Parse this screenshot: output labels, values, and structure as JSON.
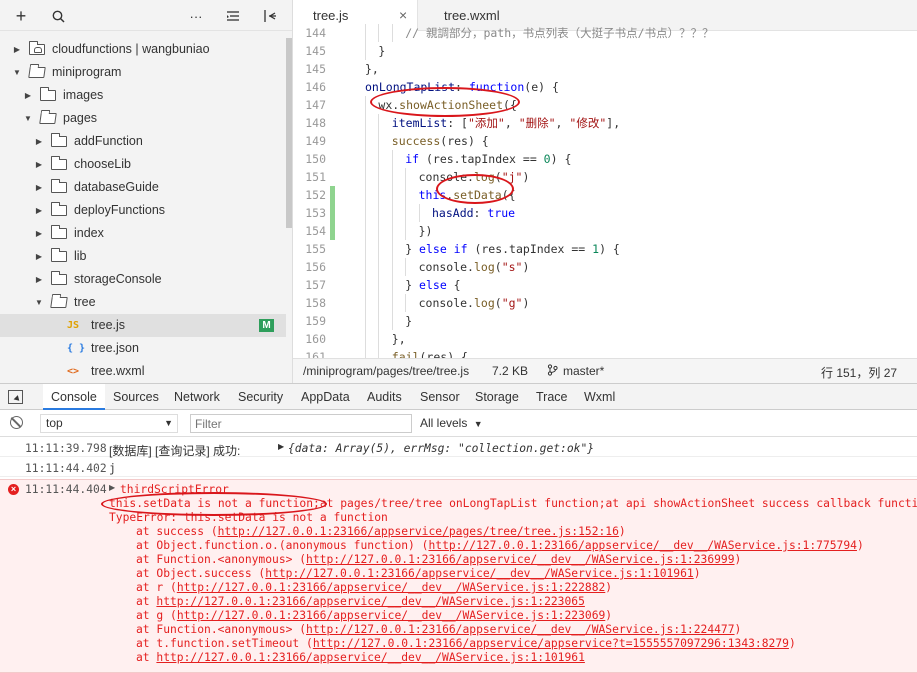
{
  "sidebar": {
    "toolbar": [
      "+",
      "search-icon",
      "···",
      "sort-icon",
      "collapse-icon"
    ],
    "tree": [
      {
        "label": "cloudfunctions | wangbuniao",
        "depth": 0,
        "expanded": false,
        "kind": "cloud-folder"
      },
      {
        "label": "miniprogram",
        "depth": 0,
        "expanded": true,
        "kind": "folder"
      },
      {
        "label": "images",
        "depth": 1,
        "expanded": false,
        "kind": "folder"
      },
      {
        "label": "pages",
        "depth": 1,
        "expanded": true,
        "kind": "folder"
      },
      {
        "label": "addFunction",
        "depth": 2,
        "expanded": false,
        "kind": "folder"
      },
      {
        "label": "chooseLib",
        "depth": 2,
        "expanded": false,
        "kind": "folder"
      },
      {
        "label": "databaseGuide",
        "depth": 2,
        "expanded": false,
        "kind": "folder"
      },
      {
        "label": "deployFunctions",
        "depth": 2,
        "expanded": false,
        "kind": "folder"
      },
      {
        "label": "index",
        "depth": 2,
        "expanded": false,
        "kind": "folder"
      },
      {
        "label": "lib",
        "depth": 2,
        "expanded": false,
        "kind": "folder"
      },
      {
        "label": "storageConsole",
        "depth": 2,
        "expanded": false,
        "kind": "folder"
      },
      {
        "label": "tree",
        "depth": 2,
        "expanded": true,
        "kind": "folder"
      },
      {
        "label": "tree.js",
        "depth": 3,
        "kind": "js",
        "icon_text": "JS",
        "badge": "M",
        "selected": true
      },
      {
        "label": "tree.json",
        "depth": 3,
        "kind": "json",
        "icon_text": "{ }"
      },
      {
        "label": "tree.wxml",
        "depth": 3,
        "kind": "wxml",
        "icon_text": "<>"
      }
    ]
  },
  "editor": {
    "tabs": [
      {
        "label": "tree.js",
        "active": true,
        "close": "×"
      },
      {
        "label": "tree.wxml",
        "active": false
      }
    ],
    "lines": [
      {
        "n": "144",
        "indent": 3,
        "html": "<span class='cm'>// 親調部分，path，书点列表（大挺子书点/书点）？？？</span>"
      },
      {
        "n": "145",
        "indent": 1,
        "html": "}"
      },
      {
        "n": "145",
        "indent": 0,
        "html": "},"
      },
      {
        "n": "146",
        "indent": 0,
        "html": "<span class='prop'>onLongTapList</span>: <span class='kw'>function</span>(e) {"
      },
      {
        "n": "147",
        "indent": 1,
        "html": "wx.<span class='fn'>showActionSheet</span>({"
      },
      {
        "n": "148",
        "indent": 2,
        "html": "<span class='prop'>itemList</span>: [<span class='str'>\"添加\"</span>, <span class='str'>\"删除\"</span>, <span class='str'>\"修改\"</span>],"
      },
      {
        "n": "149",
        "indent": 2,
        "html": "<span class='fn'>success</span>(res) {"
      },
      {
        "n": "150",
        "indent": 3,
        "html": "<span class='kw'>if</span> (res.tapIndex == <span class='num'>0</span>) {"
      },
      {
        "n": "151",
        "indent": 4,
        "html": "console.<span class='fn'>log</span>(<span class='str'>\"j\"</span>)"
      },
      {
        "n": "152",
        "indent": 4,
        "html": "<span class='kw'>this</span>.<span class='fn'>setData</span>({",
        "mark": true
      },
      {
        "n": "153",
        "indent": 5,
        "html": "<span class='prop'>hasAdd</span>: <span class='kw'>true</span>",
        "mark": true
      },
      {
        "n": "154",
        "indent": 4,
        "html": "})",
        "mark": true
      },
      {
        "n": "155",
        "indent": 3,
        "html": "} <span class='kw'>else if</span> (res.tapIndex == <span class='num'>1</span>) {"
      },
      {
        "n": "156",
        "indent": 4,
        "html": "console.<span class='fn'>log</span>(<span class='str'>\"s\"</span>)"
      },
      {
        "n": "157",
        "indent": 3,
        "html": "} <span class='kw'>else</span> {"
      },
      {
        "n": "158",
        "indent": 4,
        "html": "console.<span class='fn'>log</span>(<span class='str'>\"g\"</span>)"
      },
      {
        "n": "159",
        "indent": 3,
        "html": "}"
      },
      {
        "n": "160",
        "indent": 2,
        "html": "},"
      },
      {
        "n": "161",
        "indent": 2,
        "html": "<span class='fn'>fail</span>(res) {"
      }
    ],
    "status": {
      "path": "/miniprogram/pages/tree/tree.js",
      "size": "7.2 KB",
      "branch": "master*",
      "position": "行 151，列 27"
    }
  },
  "devtools": {
    "tabs": [
      "Console",
      "Sources",
      "Network",
      "Security",
      "AppData",
      "Audits",
      "Sensor",
      "Storage",
      "Trace",
      "Wxml"
    ],
    "active_tab": "Console",
    "context": "top",
    "filter_placeholder": "Filter",
    "levels": "All levels"
  },
  "console": {
    "messages": [
      {
        "time": "11:11:39.798",
        "text": "[数据库] [查询记录] 成功:",
        "object": "{data: Array(5), errMsg: \"collection.get:ok\"}"
      },
      {
        "time": "11:11:44.402",
        "text": "j"
      }
    ],
    "error": {
      "time": "11:11:44.404",
      "title": "thirdScriptError",
      "message": "this.setData is not a function;at pages/tree/tree onLongTapList function;at api showActionSheet success callback function",
      "type": "TypeError: this.setData is not a function",
      "stack": [
        {
          "prefix": "at success (",
          "link": "http://127.0.0.1:23166/appservice/pages/tree/tree.js:152:16",
          "suffix": ")"
        },
        {
          "prefix": "at Object.function.o.(anonymous function) (",
          "link": "http://127.0.0.1:23166/appservice/__dev__/WAService.js:1:775794",
          "suffix": ")"
        },
        {
          "prefix": "at Function.<anonymous> (",
          "link": "http://127.0.0.1:23166/appservice/__dev__/WAService.js:1:236999",
          "suffix": ")"
        },
        {
          "prefix": "at Object.success (",
          "link": "http://127.0.0.1:23166/appservice/__dev__/WAService.js:1:101961",
          "suffix": ")"
        },
        {
          "prefix": "at r (",
          "link": "http://127.0.0.1:23166/appservice/__dev__/WAService.js:1:222882",
          "suffix": ")"
        },
        {
          "prefix": "at ",
          "link": "http://127.0.0.1:23166/appservice/__dev__/WAService.js:1:223065",
          "suffix": ""
        },
        {
          "prefix": "at g (",
          "link": "http://127.0.0.1:23166/appservice/__dev__/WAService.js:1:223069",
          "suffix": ")"
        },
        {
          "prefix": "at Function.<anonymous> (",
          "link": "http://127.0.0.1:23166/appservice/__dev__/WAService.js:1:224477",
          "suffix": ")"
        },
        {
          "prefix": "at t.function.setTimeout (",
          "link": "http://127.0.0.1:23166/appservice/appservice?t=1555557097296:1343:8279",
          "suffix": ")"
        },
        {
          "prefix": "at ",
          "link": "http://127.0.0.1:23166/appservice/__dev__/WAService.js:1:101961",
          "suffix": ""
        }
      ]
    }
  },
  "colors": {
    "error": "#e41f1f",
    "annotation": "#d9161b",
    "badge": "#2e9e5b",
    "tab_underline": "#2a7be0"
  }
}
